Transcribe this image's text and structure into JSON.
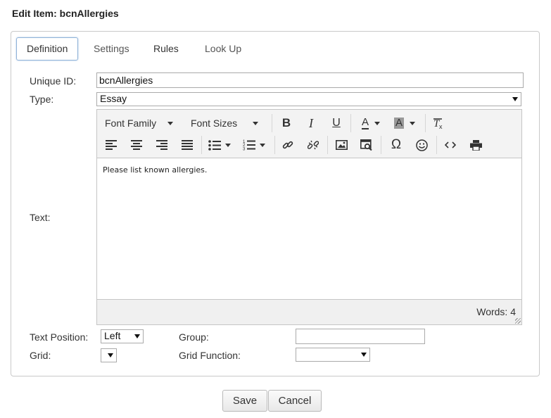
{
  "dialog": {
    "title": "Edit Item: bcnAllergies"
  },
  "tabs": [
    {
      "label": "Definition"
    },
    {
      "label": "Settings"
    },
    {
      "label": "Rules"
    },
    {
      "label": "Look Up"
    }
  ],
  "form": {
    "unique_id": {
      "label": "Unique ID:",
      "value": "bcnAllergies"
    },
    "type": {
      "label": "Type:",
      "value": "Essay"
    },
    "text": {
      "label": "Text:"
    },
    "text_position": {
      "label": "Text Position:",
      "value": "Left"
    },
    "grid": {
      "label": "Grid:",
      "value": ""
    },
    "group": {
      "label": "Group:",
      "value": ""
    },
    "grid_function": {
      "label": "Grid Function:",
      "value": ""
    }
  },
  "editor": {
    "font_family_label": "Font Family",
    "font_sizes_label": "Font Sizes",
    "bold_label": "B",
    "italic_label": "I",
    "underline_label": "U",
    "text_color_label": "A",
    "bg_color_label": "A",
    "content": "Please list known allergies.",
    "word_count": "Words: 4",
    "icons": {
      "align_left": "align-left-icon",
      "align_center": "align-center-icon",
      "align_right": "align-right-icon",
      "justify": "align-justify-icon",
      "bullet_list": "bullet-list-icon",
      "numbered_list": "numbered-list-icon",
      "link": "link-icon",
      "unlink": "unlink-icon",
      "image": "image-icon",
      "media": "media-icon",
      "special_char": "omega-icon",
      "emoticon": "smiley-icon",
      "source_code": "code-icon",
      "print": "print-icon",
      "clear_format": "clear-format-icon"
    }
  },
  "buttons": {
    "save": "Save",
    "cancel": "Cancel"
  }
}
